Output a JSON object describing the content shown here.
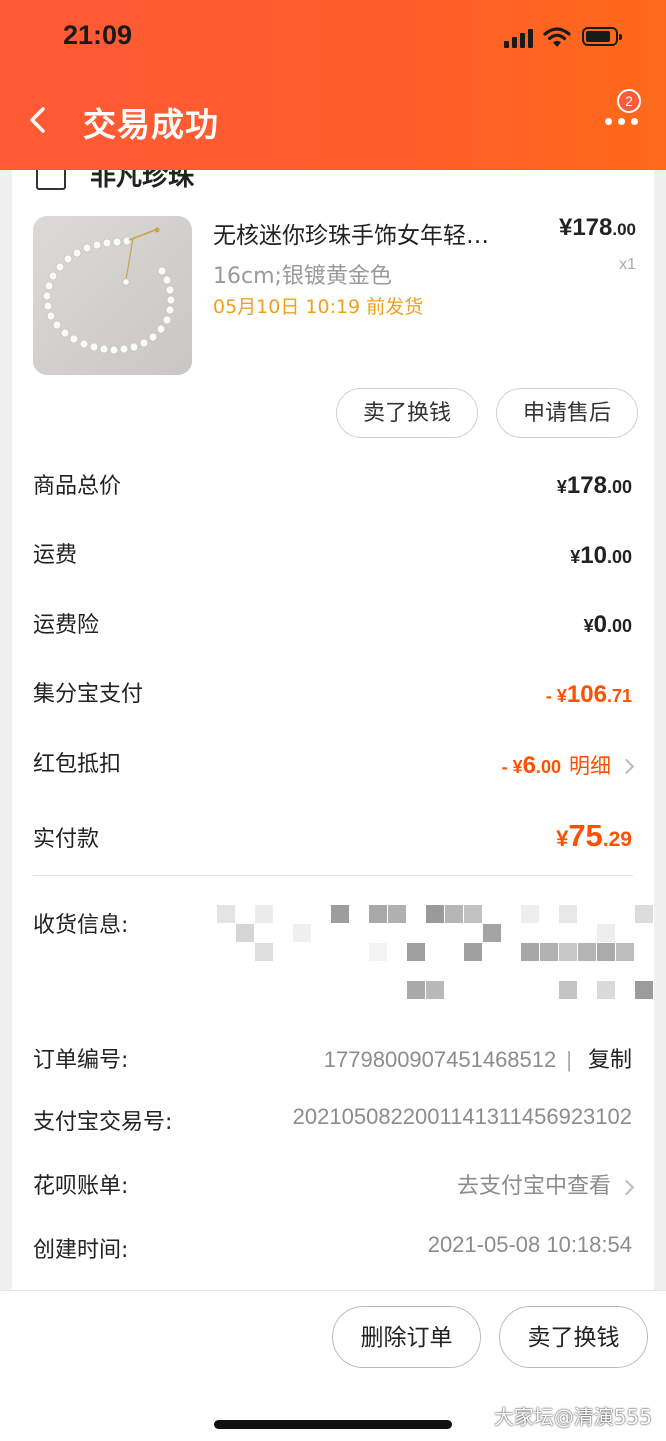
{
  "status_bar": {
    "time": "21:09"
  },
  "header": {
    "title": "交易成功",
    "badge_count": "2"
  },
  "shop": {
    "name": "非凡珍珠"
  },
  "product": {
    "title": "无核迷你珍珠手饰女年轻…",
    "price_main": "¥178",
    "price_dec": ".00",
    "sku": "16cm;银镀黄金色",
    "qty": "x1",
    "ship_note": "05月10日 10:19 前发货"
  },
  "actions": {
    "sell": "卖了换钱",
    "after_sale": "申请售后"
  },
  "costs": {
    "goods_total_label": "商品总价",
    "goods_total_int": "178",
    "goods_total_dec": ".00",
    "shipping_label": "运费",
    "shipping_int": "10",
    "shipping_dec": ".00",
    "insurance_label": "运费险",
    "insurance_int": "0",
    "insurance_dec": ".00",
    "jifenbao_label": "集分宝支付",
    "jifenbao_int": "106",
    "jifenbao_dec": ".71",
    "redpacket_label": "红包抵扣",
    "redpacket_int": "6",
    "redpacket_dec": ".00",
    "redpacket_detail": "明细",
    "paid_label": "实付款",
    "paid_int": "75",
    "paid_dec": ".29",
    "currency": "¥",
    "minus": "- "
  },
  "info": {
    "address_label": "收货信息:",
    "order_no_label": "订单编号:",
    "order_no": "1779800907451468512",
    "copy": "复制",
    "alipay_label": "支付宝交易号:",
    "alipay_no": "2021050822001141311456923102",
    "huabei_label": "花呗账单:",
    "huabei_value": "去支付宝中查看",
    "created_label": "创建时间:",
    "created_value": "2021-05-08 10:18:54"
  },
  "bottom": {
    "delete": "删除订单",
    "sell": "卖了换钱",
    "watermark": "大家坛@清演555"
  },
  "colors": {
    "header": "#ff5a37",
    "accent": "#ff5000",
    "ship_note": "#f0a020"
  }
}
